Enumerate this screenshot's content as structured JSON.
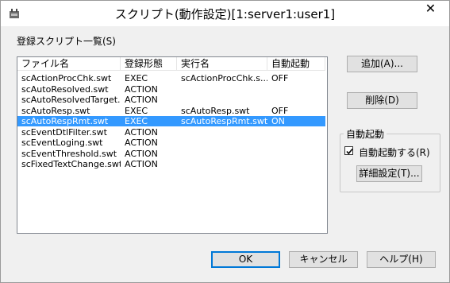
{
  "window": {
    "title": "スクリプト(動作設定)[1:server1:user1]",
    "close_label": "✕"
  },
  "list": {
    "label": "登録スクリプト一覧(S)",
    "columns": [
      "ファイル名",
      "登録形態",
      "実行名",
      "自動起動"
    ],
    "rows": [
      {
        "file": "scActionProcChk.swt",
        "type": "EXEC",
        "exec": "scActionProcChk.s...",
        "auto": "OFF",
        "selected": false
      },
      {
        "file": "scAutoResolved.swt",
        "type": "ACTION",
        "exec": "",
        "auto": "",
        "selected": false
      },
      {
        "file": "scAutoResolvedTarget...",
        "type": "ACTION",
        "exec": "",
        "auto": "",
        "selected": false
      },
      {
        "file": "scAutoResp.swt",
        "type": "EXEC",
        "exec": "scAutoResp.swt",
        "auto": "OFF",
        "selected": false
      },
      {
        "file": "scAutoRespRmt.swt",
        "type": "EXEC",
        "exec": "scAutoRespRmt.swt",
        "auto": "ON",
        "selected": true
      },
      {
        "file": "scEventDtlFilter.swt",
        "type": "ACTION",
        "exec": "",
        "auto": "",
        "selected": false
      },
      {
        "file": "scEventLoging.swt",
        "type": "ACTION",
        "exec": "",
        "auto": "",
        "selected": false
      },
      {
        "file": "scEventThreshold.swt",
        "type": "ACTION",
        "exec": "",
        "auto": "",
        "selected": false
      },
      {
        "file": "scFixedTextChange.swt",
        "type": "ACTION",
        "exec": "",
        "auto": "",
        "selected": false
      }
    ]
  },
  "buttons": {
    "add": "追加(A)...",
    "delete": "削除(D)",
    "detail": "詳細設定(T)...",
    "ok": "OK",
    "cancel": "キャンセル",
    "help": "ヘルプ(H)"
  },
  "autostart": {
    "group_label": "自動起動",
    "checkbox_label": "自動起動する(R)",
    "checked": true
  }
}
